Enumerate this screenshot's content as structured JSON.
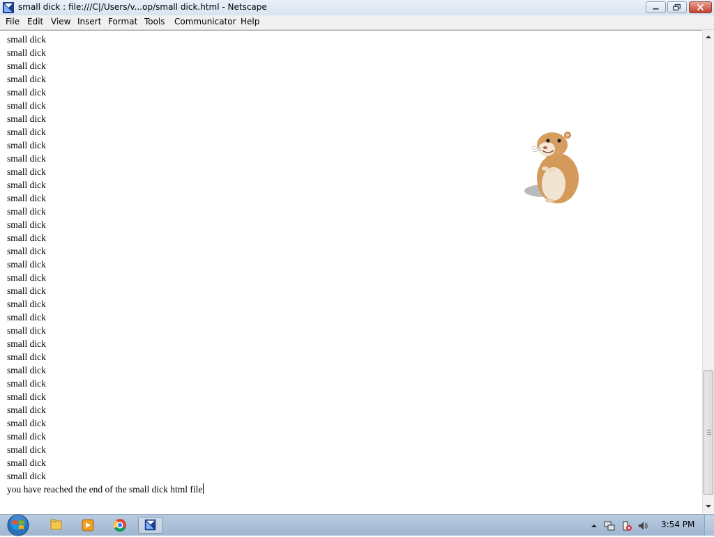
{
  "window": {
    "title": "small dick : file:///C|/Users/v...op/small dick.html - Netscape",
    "app_icon": "netscape-icon"
  },
  "menu": [
    "File",
    "Edit",
    "View",
    "Insert",
    "Format",
    "Tools",
    "Communicator",
    "Help"
  ],
  "content": {
    "lines": [
      "small dick",
      "small dick",
      "small dick",
      "small dick",
      "small dick",
      "small dick",
      "small dick",
      "small dick",
      "small dick",
      "small dick",
      "small dick",
      "small dick",
      "small dick",
      "small dick",
      "small dick",
      "small dick",
      "small dick",
      "small dick",
      "small dick",
      "small dick",
      "small dick",
      "small dick",
      "small dick",
      "small dick",
      "small dick",
      "small dick",
      "small dick",
      "small dick",
      "small dick",
      "small dick",
      "small dick",
      "small dick",
      "small dick",
      "small dick"
    ],
    "end_text": "you have reached the end of the small dick html file",
    "image": "hamster-image"
  },
  "taskbar": {
    "start": "windows-start-orb",
    "pinned": [
      "explorer-icon",
      "media-player-icon",
      "chrome-icon",
      "netscape-icon"
    ],
    "tray_icons": [
      "show-hidden-icons-arrow",
      "network-icon",
      "action-center-icon",
      "volume-icon"
    ],
    "clock": "3:54 PM"
  },
  "colors": {
    "titlebar": "#dbe6f3",
    "close_button": "#c7422e",
    "taskbar": "#a9bfd8"
  }
}
